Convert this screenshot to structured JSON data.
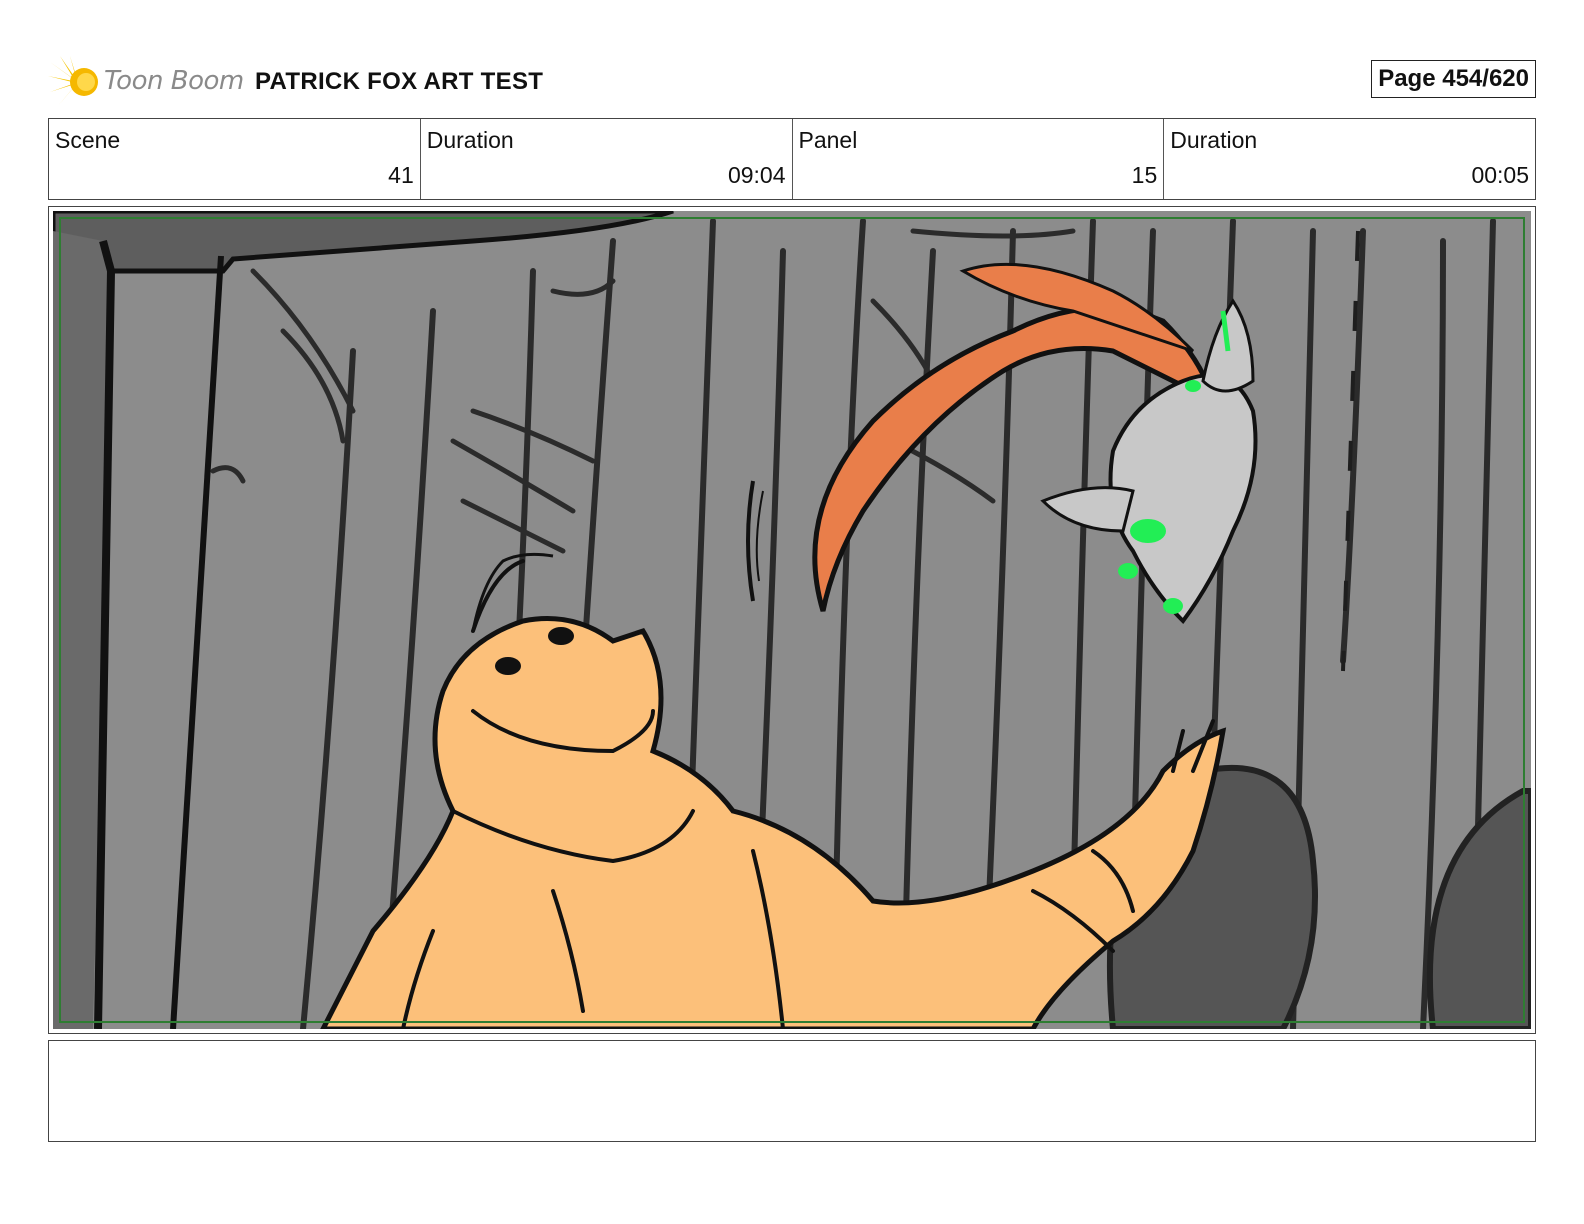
{
  "header": {
    "logo_text": "Toon Boom",
    "title": "PATRICK FOX ART TEST",
    "page": "Page 454/620"
  },
  "info": [
    {
      "label": "Scene",
      "value": "41"
    },
    {
      "label": "Duration",
      "value": "09:04"
    },
    {
      "label": "Panel",
      "value": "15"
    },
    {
      "label": "Duration",
      "value": "00:05"
    }
  ],
  "colors": {
    "background_gray": "#8c8c8c",
    "safe_frame": "#2e7d32",
    "fox_orange": "#e97e4a",
    "figure_tan": "#fcc07a",
    "accent_green": "#22ee55",
    "logo_yellow": "#f5c400"
  },
  "notes": ""
}
